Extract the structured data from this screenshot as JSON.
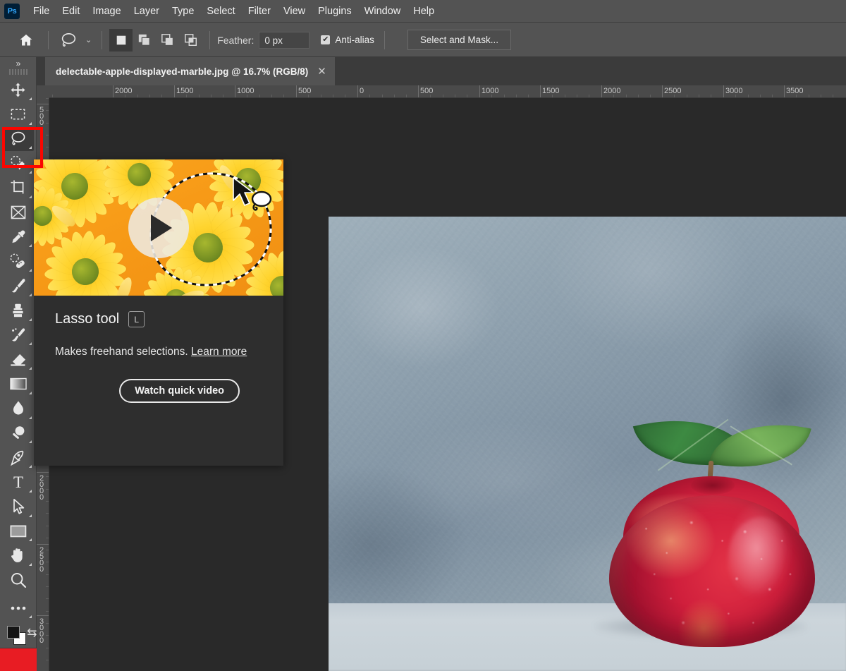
{
  "app": {
    "name": "Ps",
    "accent_color": "#1473b7",
    "chrome_color": "#535353",
    "canvas_bg": "#292929"
  },
  "menubar": {
    "logo": "Ps",
    "items": [
      "File",
      "Edit",
      "Image",
      "Layer",
      "Type",
      "Select",
      "Filter",
      "View",
      "Plugins",
      "Window",
      "Help"
    ]
  },
  "options_bar": {
    "home_icon": "home-icon",
    "active_tool_icon": "lasso-icon",
    "preset_chevron": "chevron-down-icon",
    "selection_modes": [
      {
        "name": "new-selection",
        "icon": "filled-square-icon",
        "active": true
      },
      {
        "name": "add-to-selection",
        "icon": "two-squares-union-icon",
        "active": false
      },
      {
        "name": "subtract-from-selection",
        "icon": "two-squares-subtract-icon",
        "active": false
      },
      {
        "name": "intersect-with-selection",
        "icon": "two-squares-intersect-icon",
        "active": false
      }
    ],
    "feather_label": "Feather:",
    "feather_value": "0 px",
    "antialias_label": "Anti-alias",
    "antialias_checked": true,
    "select_and_mask_label": "Select and Mask..."
  },
  "toolbar": {
    "expand_icon": "double-chevron-right-icon",
    "tools": [
      {
        "name": "move-tool",
        "icon": "move-icon",
        "selected": false,
        "has_flyout": true
      },
      {
        "name": "rectangular-marquee-tool",
        "icon": "marquee-icon",
        "selected": false,
        "has_flyout": true
      },
      {
        "name": "lasso-tool",
        "icon": "lasso-icon",
        "selected": true,
        "has_flyout": true
      },
      {
        "name": "object-selection-tool",
        "icon": "quick-selection-icon",
        "selected": false,
        "has_flyout": true
      },
      {
        "name": "crop-tool",
        "icon": "crop-icon",
        "selected": false,
        "has_flyout": true
      },
      {
        "name": "frame-tool",
        "icon": "frame-icon",
        "selected": false,
        "has_flyout": false
      },
      {
        "name": "eyedropper-tool",
        "icon": "eyedropper-icon",
        "selected": false,
        "has_flyout": true
      },
      {
        "name": "spot-healing-brush-tool",
        "icon": "healing-brush-icon",
        "selected": false,
        "has_flyout": true
      },
      {
        "name": "brush-tool",
        "icon": "brush-icon",
        "selected": false,
        "has_flyout": true
      },
      {
        "name": "clone-stamp-tool",
        "icon": "clone-stamp-icon",
        "selected": false,
        "has_flyout": true
      },
      {
        "name": "history-brush-tool",
        "icon": "history-brush-icon",
        "selected": false,
        "has_flyout": true
      },
      {
        "name": "eraser-tool",
        "icon": "eraser-icon",
        "selected": false,
        "has_flyout": true
      },
      {
        "name": "gradient-tool",
        "icon": "gradient-icon",
        "selected": false,
        "has_flyout": true
      },
      {
        "name": "blur-tool",
        "icon": "water-drop-icon",
        "selected": false,
        "has_flyout": true
      },
      {
        "name": "dodge-tool",
        "icon": "dodge-icon",
        "selected": false,
        "has_flyout": true
      },
      {
        "name": "pen-tool",
        "icon": "pen-icon",
        "selected": false,
        "has_flyout": true
      },
      {
        "name": "type-tool",
        "icon": "text-t-icon",
        "selected": false,
        "has_flyout": true
      },
      {
        "name": "path-selection-tool",
        "icon": "arrow-cursor-icon",
        "selected": false,
        "has_flyout": true
      },
      {
        "name": "rectangle-tool",
        "icon": "rectangle-icon",
        "selected": false,
        "has_flyout": true
      },
      {
        "name": "hand-tool",
        "icon": "hand-icon",
        "selected": false,
        "has_flyout": true
      },
      {
        "name": "zoom-tool",
        "icon": "magnifier-icon",
        "selected": false,
        "has_flyout": false
      },
      {
        "name": "edit-toolbar",
        "icon": "ellipsis-icon",
        "selected": false,
        "has_flyout": true
      }
    ],
    "foreground_color": "#151515",
    "background_color": "#ffffff",
    "swap_icon": "swap-arrows-icon",
    "bottom_swatch_color": "#e81c23",
    "highlight_color": "#fb0600",
    "highlighted_tool": "lasso-tool"
  },
  "document_tab": {
    "title": "delectable-apple-displayed-marble.jpg @ 16.7% (RGB/8)",
    "filename": "delectable-apple-displayed-marble.jpg",
    "zoom": "16.7%",
    "color_mode": "RGB/8",
    "close_icon": "close-icon"
  },
  "rulers": {
    "unit": "px",
    "horizontal_labels": [
      "2000",
      "1500",
      "1000",
      "500",
      "0",
      "500",
      "1000",
      "1500",
      "2000",
      "2500",
      "3000",
      "3500"
    ],
    "horizontal_positions": [
      108,
      195,
      281,
      368,
      455,
      541,
      628,
      714,
      801,
      887,
      974,
      1060
    ],
    "vertical_labels": [
      "500",
      "2000",
      "2500",
      "3000"
    ],
    "vertical_positions": [
      8,
      530,
      632,
      733
    ]
  },
  "tooltip": {
    "title": "Lasso tool",
    "shortcut": "L",
    "description": "Makes freehand selections.",
    "link_text": "Learn more",
    "cta_label": "Watch quick video",
    "thumbnail": {
      "subject": "yellow-daisy-flowers-on-orange-background",
      "play_icon": "play-triangle-icon",
      "overlay": "dashed-lasso-selection-path",
      "cursor_icon": "lasso-cursor-icon"
    }
  },
  "canvas": {
    "image_subject": "red-apple-with-green-leaves-on-blue-marble-background",
    "apple_color": "#d01f3c",
    "leaf_color": "#3d8a42",
    "background_color": "#8d9fad",
    "table_color": "#c6d0d6"
  }
}
